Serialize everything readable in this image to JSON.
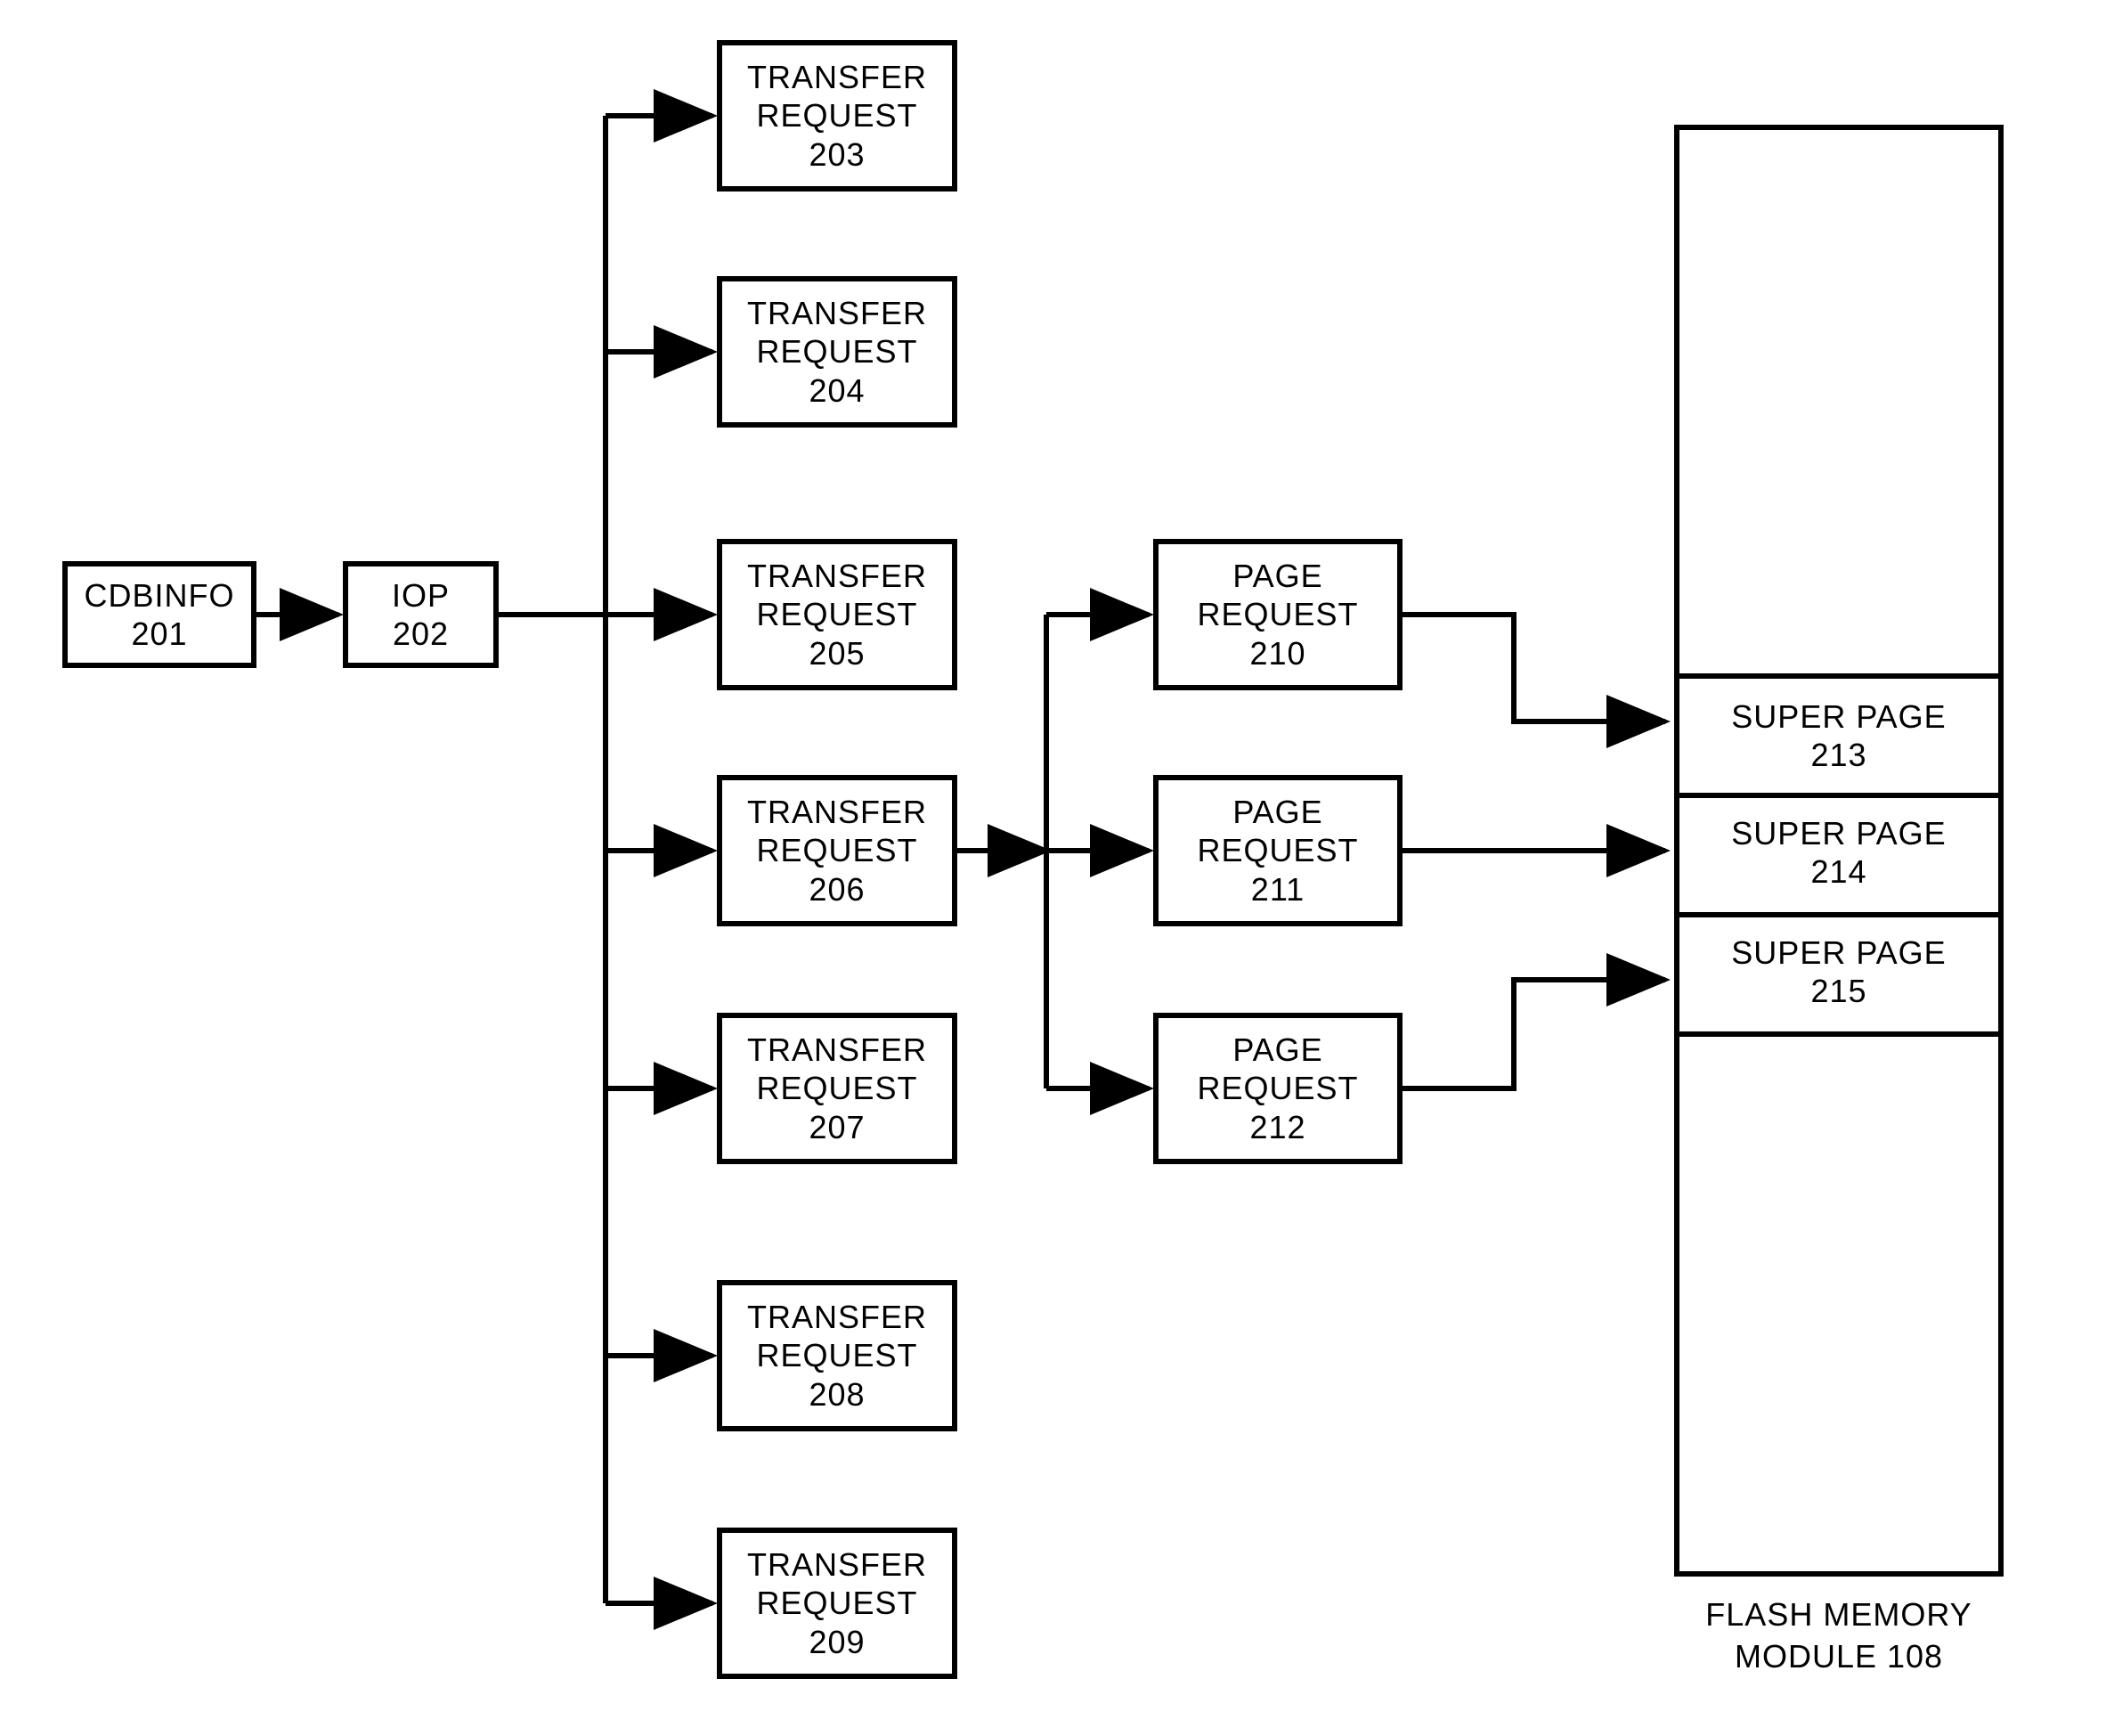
{
  "cdbinfo": {
    "label": "CDBINFO",
    "num": "201"
  },
  "iop": {
    "label": "IOP",
    "num": "202"
  },
  "transfer_requests": [
    {
      "label": "TRANSFER REQUEST",
      "num": "203"
    },
    {
      "label": "TRANSFER REQUEST",
      "num": "204"
    },
    {
      "label": "TRANSFER REQUEST",
      "num": "205"
    },
    {
      "label": "TRANSFER REQUEST",
      "num": "206"
    },
    {
      "label": "TRANSFER REQUEST",
      "num": "207"
    },
    {
      "label": "TRANSFER REQUEST",
      "num": "208"
    },
    {
      "label": "TRANSFER REQUEST",
      "num": "209"
    }
  ],
  "page_requests": [
    {
      "label": "PAGE REQUEST",
      "num": "210"
    },
    {
      "label": "PAGE REQUEST",
      "num": "211"
    },
    {
      "label": "PAGE REQUEST",
      "num": "212"
    }
  ],
  "super_pages": [
    {
      "label": "SUPER PAGE",
      "num": "213"
    },
    {
      "label": "SUPER PAGE",
      "num": "214"
    },
    {
      "label": "SUPER PAGE",
      "num": "215"
    }
  ],
  "flash_module": {
    "label": "FLASH MEMORY MODULE 108"
  }
}
